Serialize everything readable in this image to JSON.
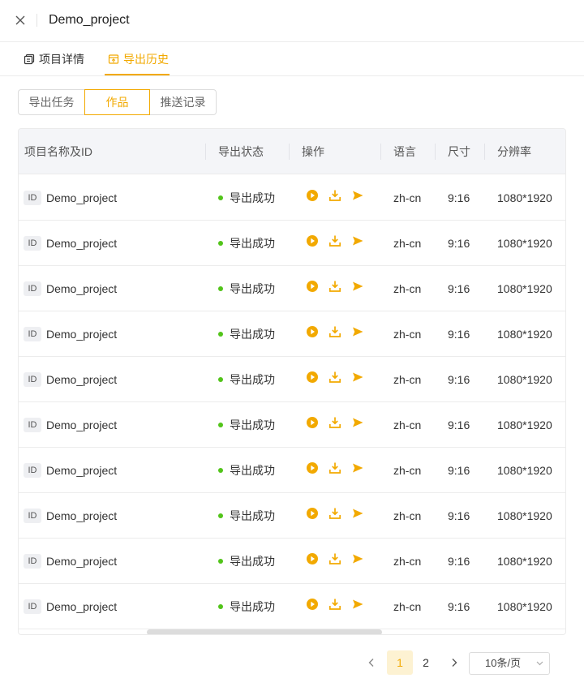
{
  "header": {
    "title": "Demo_project"
  },
  "tabs": [
    {
      "label": "项目详情",
      "active": false
    },
    {
      "label": "导出历史",
      "active": true
    }
  ],
  "segments": [
    {
      "label": "导出任务",
      "active": false
    },
    {
      "label": "作品",
      "active": true
    },
    {
      "label": "推送记录",
      "active": false
    }
  ],
  "table": {
    "columns": [
      "项目名称及ID",
      "导出状态",
      "操作",
      "语言",
      "尺寸",
      "分辨率"
    ],
    "rows": [
      {
        "id_tag": "ID",
        "name": "Demo_project",
        "status": "导出成功",
        "language": "zh-cn",
        "size": "9:16",
        "resolution": "1080*1920"
      },
      {
        "id_tag": "ID",
        "name": "Demo_project",
        "status": "导出成功",
        "language": "zh-cn",
        "size": "9:16",
        "resolution": "1080*1920"
      },
      {
        "id_tag": "ID",
        "name": "Demo_project",
        "status": "导出成功",
        "language": "zh-cn",
        "size": "9:16",
        "resolution": "1080*1920"
      },
      {
        "id_tag": "ID",
        "name": "Demo_project",
        "status": "导出成功",
        "language": "zh-cn",
        "size": "9:16",
        "resolution": "1080*1920"
      },
      {
        "id_tag": "ID",
        "name": "Demo_project",
        "status": "导出成功",
        "language": "zh-cn",
        "size": "9:16",
        "resolution": "1080*1920"
      },
      {
        "id_tag": "ID",
        "name": "Demo_project",
        "status": "导出成功",
        "language": "zh-cn",
        "size": "9:16",
        "resolution": "1080*1920"
      },
      {
        "id_tag": "ID",
        "name": "Demo_project",
        "status": "导出成功",
        "language": "zh-cn",
        "size": "9:16",
        "resolution": "1080*1920"
      },
      {
        "id_tag": "ID",
        "name": "Demo_project",
        "status": "导出成功",
        "language": "zh-cn",
        "size": "9:16",
        "resolution": "1080*1920"
      },
      {
        "id_tag": "ID",
        "name": "Demo_project",
        "status": "导出成功",
        "language": "zh-cn",
        "size": "9:16",
        "resolution": "1080*1920"
      },
      {
        "id_tag": "ID",
        "name": "Demo_project",
        "status": "导出成功",
        "language": "zh-cn",
        "size": "9:16",
        "resolution": "1080*1920"
      }
    ],
    "actions": [
      "play-icon",
      "download-icon",
      "send-icon"
    ]
  },
  "pagination": {
    "pages": [
      "1",
      "2"
    ],
    "current": "1",
    "page_size": "10条/页"
  },
  "colors": {
    "accent": "#f2a900",
    "success": "#52c41a"
  }
}
